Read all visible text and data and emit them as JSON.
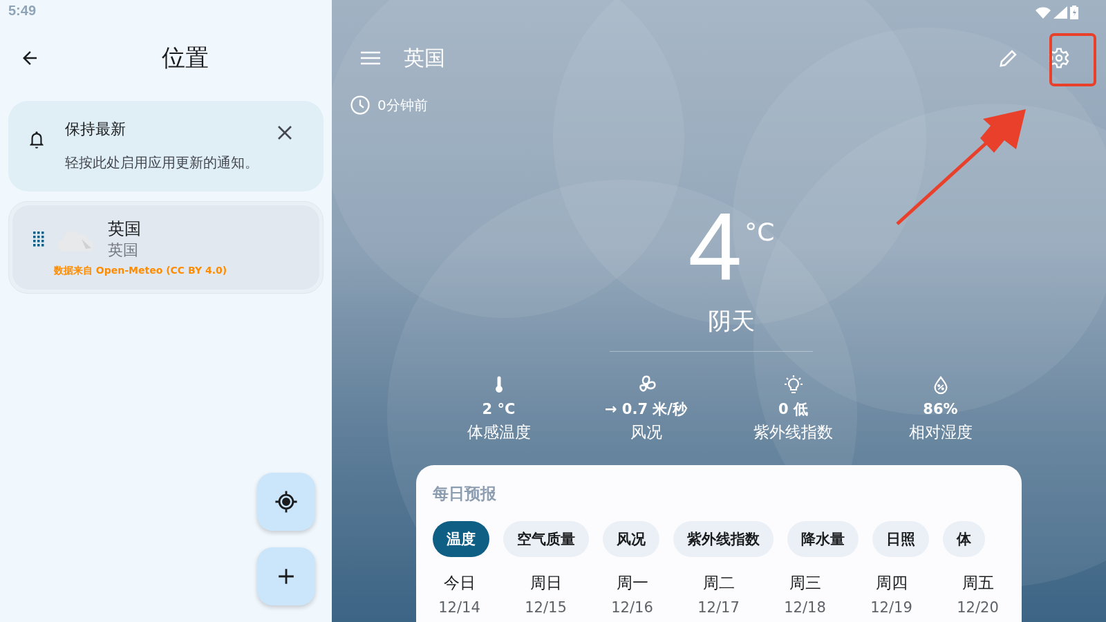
{
  "status_bar": {
    "time": "5:49"
  },
  "locations_panel": {
    "title": "位置",
    "notice": {
      "title": "保持最新",
      "message": "轻按此处启用应用更新的通知。"
    },
    "locations": [
      {
        "name": "英国",
        "subtitle": "英国",
        "source": "数据来自 Open-Meteo (CC BY 4.0)"
      }
    ]
  },
  "weather": {
    "title": "英国",
    "updated": "0分钟前",
    "temperature": "4",
    "unit": "°C",
    "condition": "阴天",
    "details": [
      {
        "kind": "thermometer",
        "value": "2 °C",
        "label": "体感温度"
      },
      {
        "kind": "fan",
        "value": "→ 0.7 米/秒",
        "label": "风况"
      },
      {
        "kind": "bulb",
        "value": "0 低",
        "label": "紫外线指数"
      },
      {
        "kind": "drop",
        "value": "86%",
        "label": "相对湿度"
      }
    ],
    "daily_forecast": {
      "title": "每日预报",
      "tabs": [
        {
          "label": "温度",
          "selected": true
        },
        {
          "label": "空气质量",
          "selected": false
        },
        {
          "label": "风况",
          "selected": false
        },
        {
          "label": "紫外线指数",
          "selected": false
        },
        {
          "label": "降水量",
          "selected": false
        },
        {
          "label": "日照",
          "selected": false
        },
        {
          "label": "体",
          "selected": false
        }
      ],
      "days": [
        {
          "day": "今日",
          "date": "12/14"
        },
        {
          "day": "周日",
          "date": "12/15"
        },
        {
          "day": "周一",
          "date": "12/16"
        },
        {
          "day": "周二",
          "date": "12/17"
        },
        {
          "day": "周三",
          "date": "12/18"
        },
        {
          "day": "周四",
          "date": "12/19"
        },
        {
          "day": "周五",
          "date": "12/20"
        }
      ]
    }
  }
}
